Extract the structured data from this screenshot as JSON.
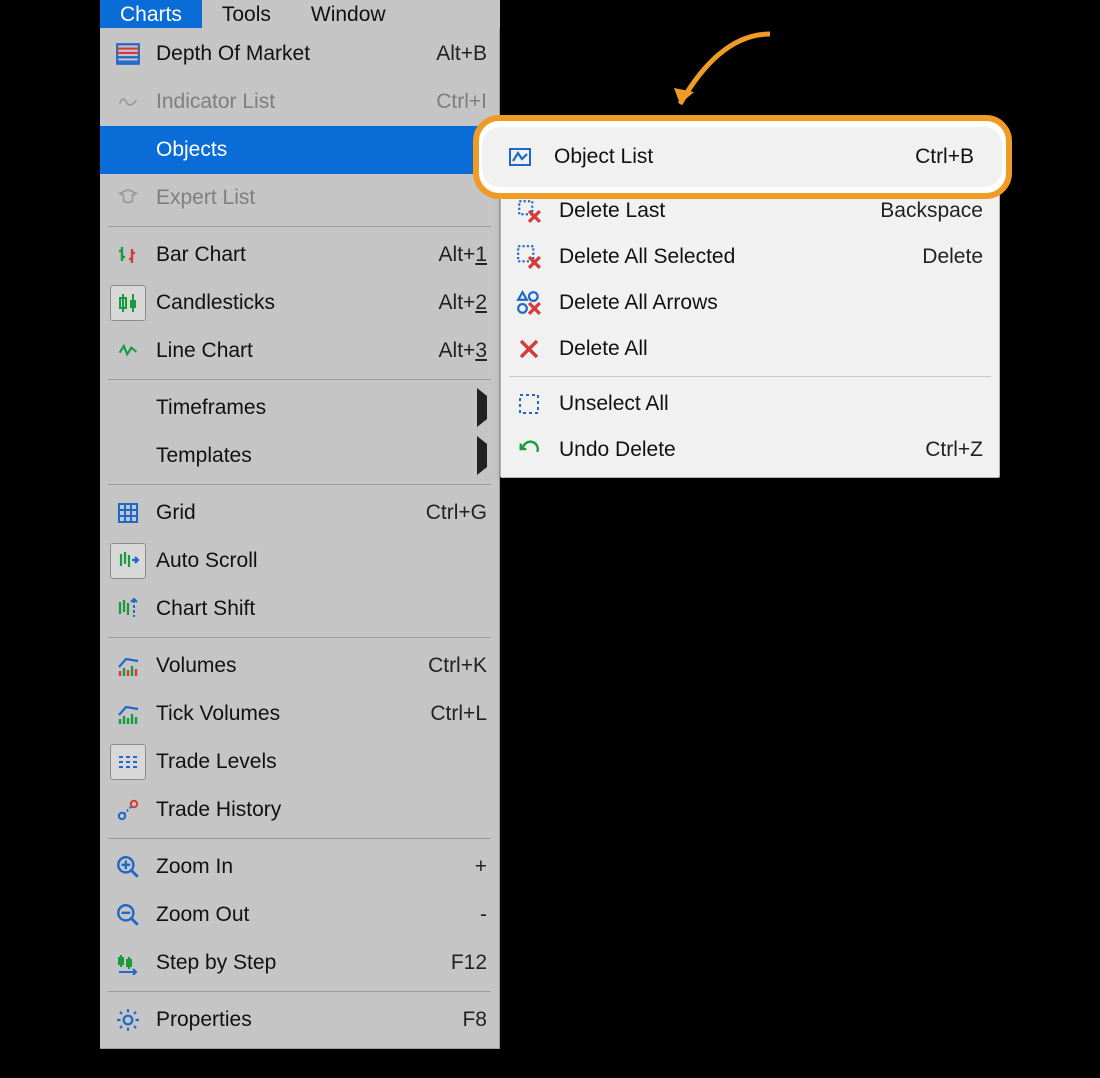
{
  "menubar": {
    "items": [
      {
        "label": "Charts",
        "active": true
      },
      {
        "label": "Tools",
        "active": false
      },
      {
        "label": "Window",
        "active": false
      }
    ]
  },
  "charts_menu": {
    "groups": [
      [
        {
          "icon": "depth-of-market-icon",
          "label": "Depth Of Market",
          "shortcut": "Alt+B",
          "disabled": false
        },
        {
          "icon": "indicator-list-icon",
          "label": "Indicator List",
          "shortcut": "Ctrl+I",
          "disabled": true
        },
        {
          "icon": "",
          "label": "Objects",
          "shortcut": "",
          "highlight": true,
          "submenu": true
        },
        {
          "icon": "expert-list-icon",
          "label": "Expert List",
          "shortcut": "",
          "disabled": true
        }
      ],
      [
        {
          "icon": "bar-chart-icon",
          "label": "Bar Chart",
          "shortcut": "Alt+1",
          "accel_last": true
        },
        {
          "icon": "candlesticks-icon",
          "label": "Candlesticks",
          "shortcut": "Alt+2",
          "boxed": true,
          "accel_last": true
        },
        {
          "icon": "line-chart-icon",
          "label": "Line Chart",
          "shortcut": "Alt+3",
          "accel_last": true
        }
      ],
      [
        {
          "icon": "",
          "label": "Timeframes",
          "shortcut": "",
          "submenu": true,
          "indent": true
        },
        {
          "icon": "",
          "label": "Templates",
          "shortcut": "",
          "submenu": true,
          "indent": true
        }
      ],
      [
        {
          "icon": "grid-icon",
          "label": "Grid",
          "shortcut": "Ctrl+G"
        },
        {
          "icon": "auto-scroll-icon",
          "label": "Auto Scroll",
          "shortcut": "",
          "boxed": true
        },
        {
          "icon": "chart-shift-icon",
          "label": "Chart Shift",
          "shortcut": ""
        }
      ],
      [
        {
          "icon": "volumes-icon",
          "label": "Volumes",
          "shortcut": "Ctrl+K"
        },
        {
          "icon": "tick-volumes-icon",
          "label": "Tick Volumes",
          "shortcut": "Ctrl+L"
        },
        {
          "icon": "trade-levels-icon",
          "label": "Trade Levels",
          "shortcut": "",
          "boxed": true
        },
        {
          "icon": "trade-history-icon",
          "label": "Trade History",
          "shortcut": ""
        }
      ],
      [
        {
          "icon": "zoom-in-icon",
          "label": "Zoom In",
          "shortcut": "+"
        },
        {
          "icon": "zoom-out-icon",
          "label": "Zoom Out",
          "shortcut": "-"
        },
        {
          "icon": "step-by-step-icon",
          "label": "Step by Step",
          "shortcut": "F12"
        }
      ],
      [
        {
          "icon": "properties-icon",
          "label": "Properties",
          "shortcut": "F8"
        }
      ]
    ]
  },
  "objects_submenu": {
    "groups": [
      [
        {
          "icon": "object-list-icon",
          "label": "Object List",
          "shortcut": "Ctrl+B",
          "highlighted": true
        }
      ],
      [
        {
          "icon": "delete-last-icon",
          "label": "Delete Last",
          "shortcut": "Backspace"
        },
        {
          "icon": "delete-all-selected-icon",
          "label": "Delete All Selected",
          "shortcut": "Delete"
        },
        {
          "icon": "delete-all-arrows-icon",
          "label": "Delete All Arrows",
          "shortcut": ""
        },
        {
          "icon": "delete-all-icon",
          "label": "Delete All",
          "shortcut": ""
        }
      ],
      [
        {
          "icon": "unselect-all-icon",
          "label": "Unselect All",
          "shortcut": ""
        },
        {
          "icon": "undo-delete-icon",
          "label": "Undo Delete",
          "shortcut": "Ctrl+Z"
        }
      ]
    ]
  }
}
